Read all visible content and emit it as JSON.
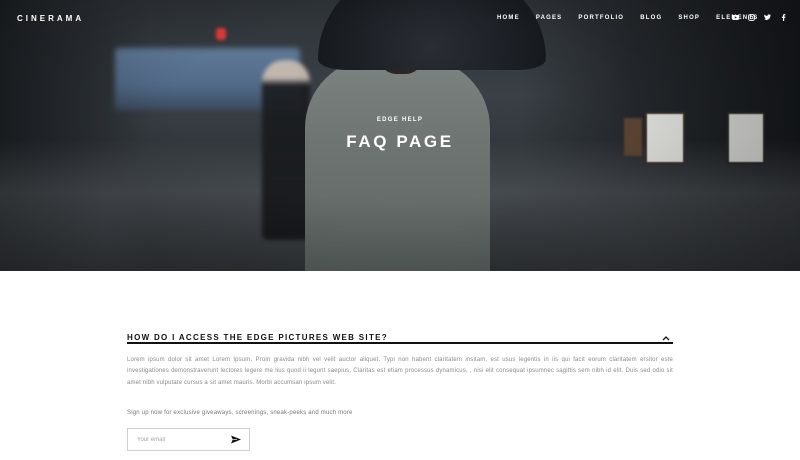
{
  "brand": {
    "logo": "CINERAMA"
  },
  "nav": {
    "items": [
      {
        "label": "HOME"
      },
      {
        "label": "PAGES"
      },
      {
        "label": "PORTFOLIO"
      },
      {
        "label": "BLOG"
      },
      {
        "label": "SHOP"
      },
      {
        "label": "ELEMENTS"
      }
    ],
    "socials": [
      "youtube-icon",
      "instagram-icon",
      "twitter-icon",
      "facebook-icon"
    ]
  },
  "hero": {
    "subtitle": "EDGE HELP",
    "title": "FAQ PAGE"
  },
  "faq": {
    "question": "HOW DO I ACCESS THE EDGE PICTURES WEB SITE?",
    "expanded": true,
    "answer": "Lorem ipsum dolor sit amet Lorem Ipsum. Proin gravida nibh vel velit auctor aliquet. Typi non habent claritatem insitam, est usus legentis in iis qui facit eorum claritatem ersitor este investigationes demonstraverunt lectores legere me lius quod ii legunt saepius. Claritas est etiam processus dynamicus, , nisi elit consequat ipsumnec sagittis sem nibh id elit. Duis sed odio sit amet nibh vulputate cursus a sit amet mauris. Morbi accumsan ipsum velit."
  },
  "signup": {
    "text": "Sign up now for exclusive giveaways, screenings, sneak-peeks and much more",
    "placeholder": "Your email"
  },
  "colors": {
    "text_dark": "#111111",
    "text_muted": "#8a8a8a",
    "hero_text": "#ffffff"
  }
}
